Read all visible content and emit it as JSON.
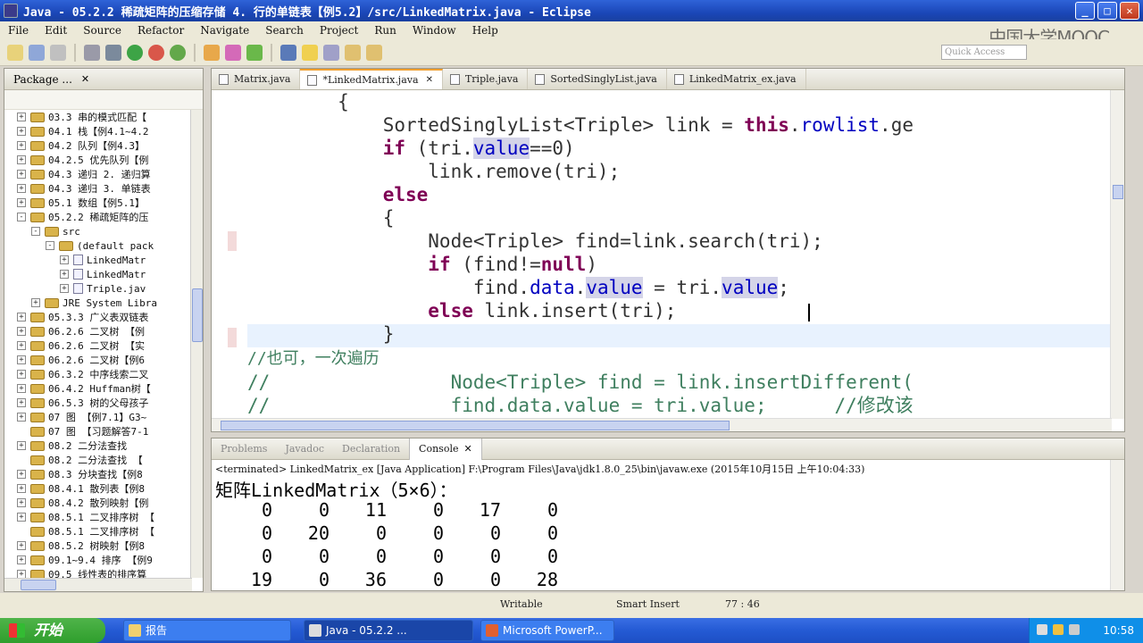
{
  "window": {
    "title": "Java - 05.2.2  稀疏矩阵的压缩存储 4. 行的单链表【例5.2】/src/LinkedMatrix.java - Eclipse",
    "minimize_icon": "minimize-icon",
    "maximize_icon": "maximize-icon",
    "close_icon": "close-icon"
  },
  "menu": [
    "File",
    "Edit",
    "Source",
    "Refactor",
    "Navigate",
    "Search",
    "Project",
    "Run",
    "Window",
    "Help"
  ],
  "watermark": "中国大学MOOC",
  "quick_access": {
    "placeholder": "Quick Access"
  },
  "package_explorer": {
    "title": "Package ...",
    "items": [
      {
        "label": "03.3  串的模式匹配【",
        "toggle": "+",
        "type": "project"
      },
      {
        "label": "04.1  栈【例4.1~4.2",
        "toggle": "+",
        "type": "project"
      },
      {
        "label": "04.2  队列【例4.3】",
        "toggle": "+",
        "type": "project"
      },
      {
        "label": "04.2.5  优先队列【例",
        "toggle": "+",
        "type": "project"
      },
      {
        "label": "04.3  递归 2. 递归算",
        "toggle": "+",
        "type": "project"
      },
      {
        "label": "04.3  递归 3. 单链表",
        "toggle": "+",
        "type": "project"
      },
      {
        "label": "05.1  数组【例5.1】",
        "toggle": "+",
        "type": "project"
      },
      {
        "label": "05.2.2  稀疏矩阵的压",
        "toggle": "-",
        "type": "project"
      },
      {
        "label": "src",
        "toggle": "-",
        "type": "folder",
        "indent": 1
      },
      {
        "label": "(default pack",
        "toggle": "-",
        "type": "folder",
        "indent": 2
      },
      {
        "label": "LinkedMatr",
        "toggle": "+",
        "type": "class",
        "indent": 3
      },
      {
        "label": "LinkedMatr",
        "toggle": "+",
        "type": "class",
        "indent": 3
      },
      {
        "label": "Triple.jav",
        "toggle": "+",
        "type": "class",
        "indent": 3
      },
      {
        "label": "JRE System Libra",
        "toggle": "+",
        "type": "folder",
        "indent": 1
      },
      {
        "label": "05.3.3  广义表双链表",
        "toggle": "+",
        "type": "project"
      },
      {
        "label": "06.2.6  二叉树 【例",
        "toggle": "+",
        "type": "project"
      },
      {
        "label": "06.2.6  二叉树 【实",
        "toggle": "+",
        "type": "project"
      },
      {
        "label": "06.2.6  二叉树【例6",
        "toggle": "+",
        "type": "project"
      },
      {
        "label": "06.3.2  中序线索二叉",
        "toggle": "+",
        "type": "project"
      },
      {
        "label": "06.4.2  Huffman树【",
        "toggle": "+",
        "type": "project"
      },
      {
        "label": "06.5.3  树的父母孩子",
        "toggle": "+",
        "type": "project"
      },
      {
        "label": "07  图 【例7.1】G3~",
        "toggle": "+",
        "type": "project"
      },
      {
        "label": "07 图 【习题解答7-1",
        "toggle": "",
        "type": "project"
      },
      {
        "label": "08.2  二分法查找",
        "toggle": "+",
        "type": "project"
      },
      {
        "label": "08.2  二分法查找 【",
        "toggle": "",
        "type": "project"
      },
      {
        "label": "08.3  分块查找【例8",
        "toggle": "+",
        "type": "project"
      },
      {
        "label": "08.4.1  散列表【例8",
        "toggle": "+",
        "type": "project"
      },
      {
        "label": "08.4.2  散列映射【例",
        "toggle": "+",
        "type": "project"
      },
      {
        "label": "08.5.1  二叉排序树 【",
        "toggle": "+",
        "type": "project"
      },
      {
        "label": "08.5.1  二叉排序树 【",
        "toggle": "",
        "type": "project"
      },
      {
        "label": "08.5.2  树映射【例8",
        "toggle": "+",
        "type": "project"
      },
      {
        "label": "09.1~9.4  排序 【例9",
        "toggle": "+",
        "type": "project"
      },
      {
        "label": "09.5 线性表的排序算",
        "toggle": "+",
        "type": "project"
      }
    ]
  },
  "editor": {
    "tabs": [
      "Matrix.java",
      "*LinkedMatrix.java",
      "Triple.java",
      "SortedSinglyList.java",
      "LinkedMatrix_ex.java"
    ],
    "active_tab": "*LinkedMatrix.java"
  },
  "console_panel": {
    "tabs": [
      "Problems",
      "Javadoc",
      "Declaration",
      "Console"
    ],
    "active_tab": "Console",
    "terminated_line": "<terminated> LinkedMatrix_ex [Java Application] F:\\Program Files\\Java\\jdk1.8.0_25\\bin\\javaw.exe (2015年10月15日 上午10:04:33)",
    "output_title": "矩阵LinkedMatrix（5×6）：",
    "matrix_rows": [
      [
        "0",
        "0",
        "11",
        "0",
        "17",
        "0"
      ],
      [
        "0",
        "20",
        "0",
        "0",
        "0",
        "0"
      ],
      [
        "0",
        "0",
        "0",
        "0",
        "0",
        "0"
      ],
      [
        "19",
        "0",
        "36",
        "0",
        "0",
        "28"
      ]
    ]
  },
  "status_bar": {
    "mode": "Writable",
    "insert": "Smart Insert",
    "position": "77 : 46"
  },
  "taskbar": {
    "start": "开始",
    "tasks": [
      "报告",
      "Java - 05.2.2  ...",
      "Microsoft PowerP..."
    ],
    "clock": "10:58"
  }
}
